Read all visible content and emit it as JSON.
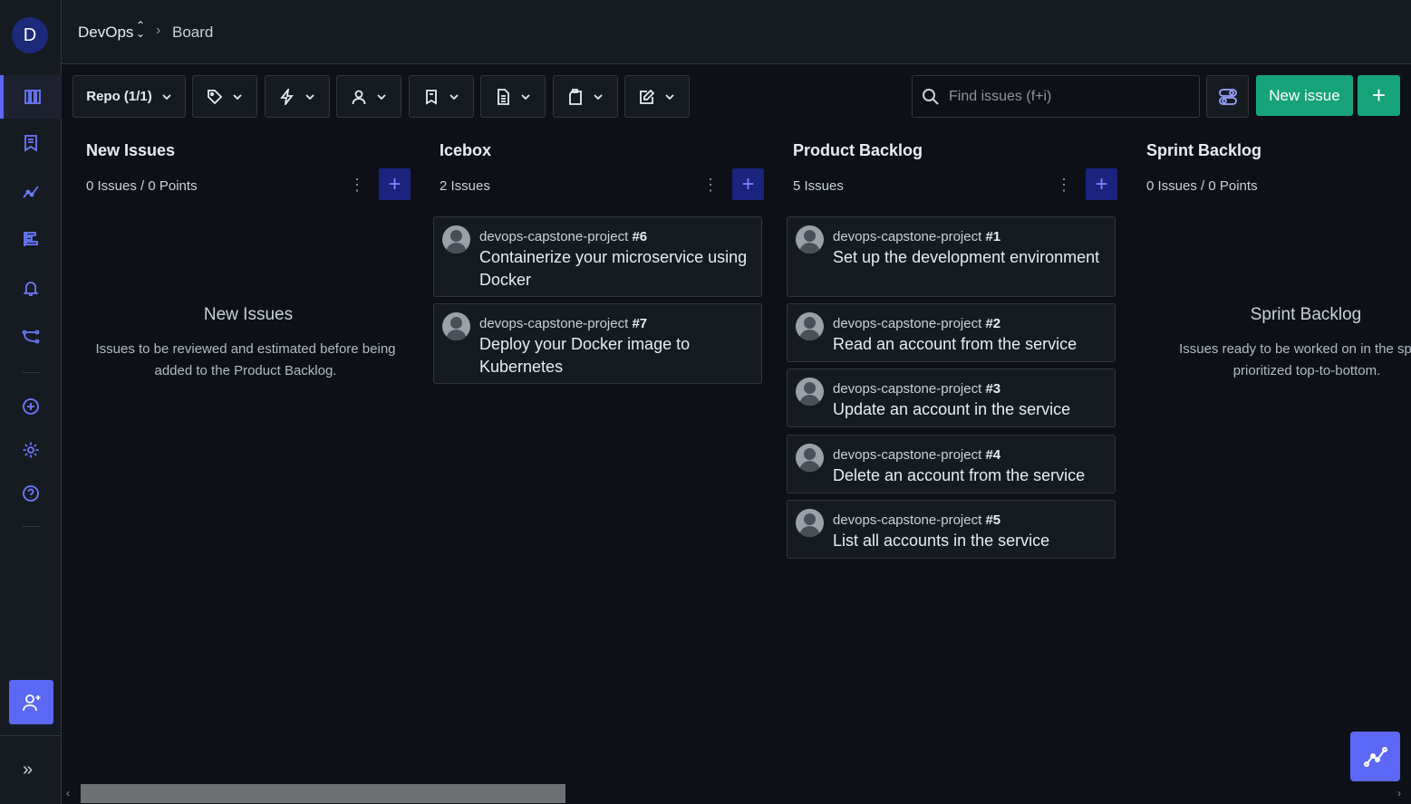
{
  "sidebar": {
    "workspace_initial": "D",
    "items": [
      {
        "name": "board",
        "icon": "board-icon"
      },
      {
        "name": "epics",
        "icon": "bookmark-icon"
      },
      {
        "name": "insights",
        "icon": "line-chart-icon"
      },
      {
        "name": "roadmap",
        "icon": "roadmap-icon"
      },
      {
        "name": "notifications",
        "icon": "bell-icon"
      },
      {
        "name": "workflows",
        "icon": "workflow-icon"
      },
      {
        "name": "add",
        "icon": "plus-circle-icon"
      },
      {
        "name": "settings",
        "icon": "gear-icon"
      },
      {
        "name": "help",
        "icon": "help-icon"
      }
    ],
    "expand_glyph": "»"
  },
  "breadcrumb": {
    "workspace": "DevOps",
    "updown": "⌃⌄",
    "separator": "›",
    "page": "Board"
  },
  "toolbar": {
    "repo_label": "Repo (1/1)",
    "search_placeholder": "Find issues (f+i)",
    "new_issue_label": "New issue",
    "new_plus": "+"
  },
  "columns": [
    {
      "title": "New Issues",
      "subtitle": "0 Issues / 0 Points",
      "menu": "⋮",
      "add": "+",
      "empty_title": "New Issues",
      "empty_desc": "Issues to be reviewed and estimated before being added to the Product Backlog."
    },
    {
      "title": "Icebox",
      "subtitle": "2 Issues",
      "menu": "⋮",
      "add": "+",
      "cards": [
        {
          "repo": "devops-capstone-project",
          "num": "#6",
          "title": "Containerize your microservice using Docker"
        },
        {
          "repo": "devops-capstone-project",
          "num": "#7",
          "title": "Deploy your Docker image to Kubernetes"
        }
      ]
    },
    {
      "title": "Product Backlog",
      "subtitle": "5 Issues",
      "menu": "⋮",
      "add": "+",
      "cards": [
        {
          "repo": "devops-capstone-project",
          "num": "#1",
          "title": "Set up the development environment"
        },
        {
          "repo": "devops-capstone-project",
          "num": "#2",
          "title": "Read an account from the service"
        },
        {
          "repo": "devops-capstone-project",
          "num": "#3",
          "title": "Update an account in the service"
        },
        {
          "repo": "devops-capstone-project",
          "num": "#4",
          "title": "Delete an account from the service"
        },
        {
          "repo": "devops-capstone-project",
          "num": "#5",
          "title": "List all accounts in the service"
        }
      ]
    },
    {
      "title": "Sprint Backlog",
      "subtitle": "0 Issues / 0 Points",
      "empty_title": "Sprint Backlog",
      "empty_desc": "Issues ready to be worked on in the sprint, prioritized top-to-bottom."
    }
  ],
  "scrollbar": {
    "left": "‹",
    "right": "›"
  },
  "colors": {
    "accent": "#5b68f6",
    "success": "#17a37a",
    "background": "#0d1117",
    "panel": "#161b22"
  }
}
